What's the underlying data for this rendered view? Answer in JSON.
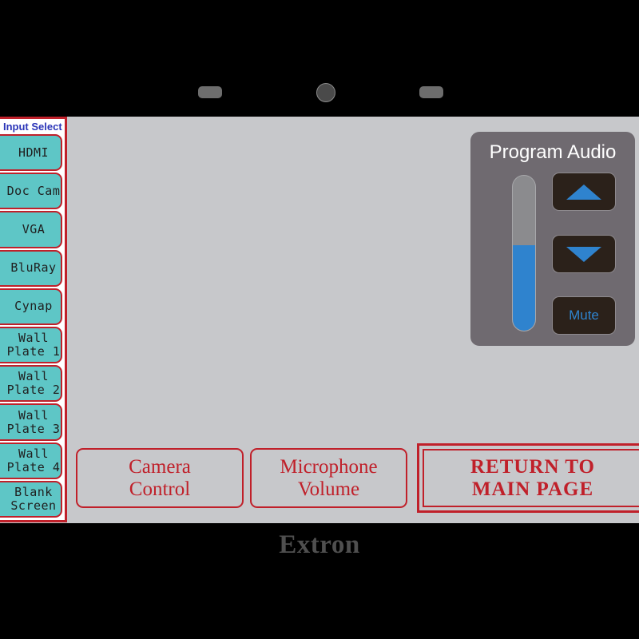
{
  "device": {
    "brand": "Extron",
    "hardware": {
      "speaker_grille_left": "speaker-grille",
      "speaker_grille_right": "speaker-grille",
      "camera_lens": "camera-lens"
    }
  },
  "input_select": {
    "title": "Input Select",
    "buttons": [
      {
        "label": "HDMI"
      },
      {
        "label": "Doc Cam"
      },
      {
        "label": "VGA"
      },
      {
        "label": "BluRay"
      },
      {
        "label": "Cynap"
      },
      {
        "label": "Wall\nPlate 1"
      },
      {
        "label": "Wall\nPlate 2"
      },
      {
        "label": "Wall\nPlate 3"
      },
      {
        "label": "Wall\nPlate 4"
      },
      {
        "label": "Blank\nScreen"
      }
    ]
  },
  "program_audio": {
    "title": "Program Audio",
    "volume_percent": 55,
    "volume_up_icon": "triangle-up-icon",
    "volume_down_icon": "triangle-down-icon",
    "mute_label": "Mute"
  },
  "actions": {
    "camera_control": "Camera\nControl",
    "microphone_volume": "Microphone\nVolume",
    "return_main_page": "RETURN TO\nMAIN PAGE"
  },
  "colors": {
    "bezel": "#000000",
    "screen_bg": "#c7c8cb",
    "accent_red": "#c0202a",
    "input_button_teal": "#5ec6c6",
    "panel_gray": "#6f6a70",
    "slider_blue": "#2f83ce",
    "title_blue": "#2b35b8",
    "audio_button_dark": "#2b211a"
  }
}
